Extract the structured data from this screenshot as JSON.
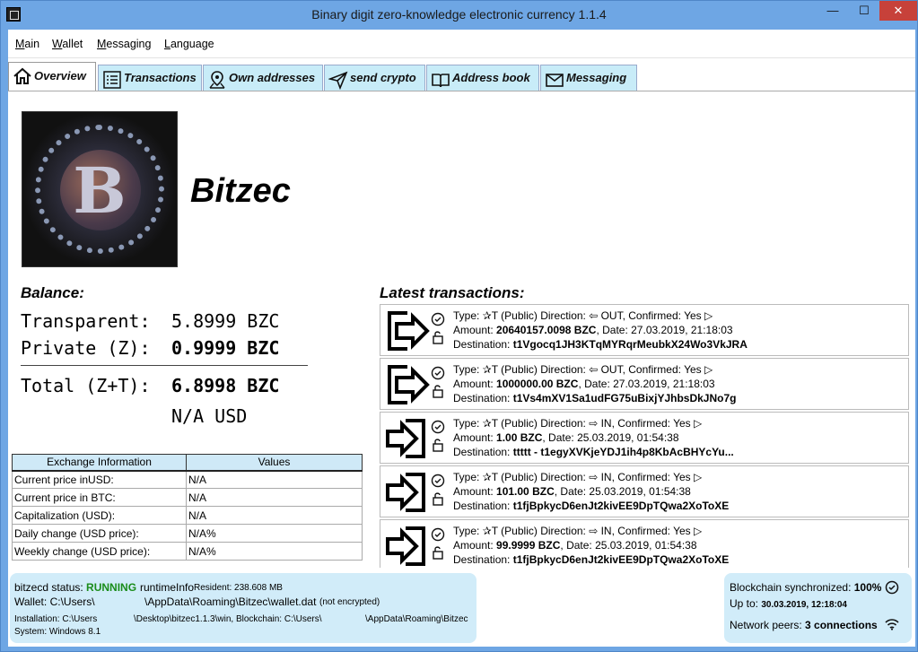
{
  "window": {
    "title": "Binary digit zero-knowledge electronic currency  1.1.4",
    "minimize": "—",
    "maximize": "☐",
    "close": "✕"
  },
  "menu": [
    "Main",
    "Wallet",
    "Messaging",
    "Language"
  ],
  "tabs": [
    {
      "label": "Overview",
      "icon": "home-icon"
    },
    {
      "label": "Transactions",
      "icon": "list-icon"
    },
    {
      "label": "Own addresses",
      "icon": "map-pin-icon"
    },
    {
      "label": "send crypto",
      "icon": "send-icon"
    },
    {
      "label": "Address book",
      "icon": "book-icon"
    },
    {
      "label": "Messaging",
      "icon": "envelope-icon"
    }
  ],
  "brand": "Bitzec",
  "balance": {
    "heading": "Balance:",
    "transparent_label": "Transparent:",
    "transparent_value": "5.8999 BZC",
    "private_label": "Private (Z):",
    "private_value": "0.9999 BZC",
    "total_label": "Total (Z+T):",
    "total_value": "6.8998 BZC",
    "usd_value": "N/A USD"
  },
  "exchange": {
    "headers": [
      "Exchange Information",
      "Values"
    ],
    "rows": [
      [
        "Current price inUSD:",
        "N/A"
      ],
      [
        "Current price in BTC:",
        "N/A"
      ],
      [
        "Capitalization (USD):",
        "N/A"
      ],
      [
        "Daily change (USD price):",
        "N/A%"
      ],
      [
        "Weekly change (USD price):",
        "N/A%"
      ]
    ]
  },
  "latest": {
    "heading": "Latest transactions:",
    "items": [
      {
        "direction": "out",
        "type": "Type: ✰T (Public) Direction: ⇦ OUT,  Confirmed: Yes ▷",
        "amount_label": "Amount: ",
        "amount": "20640157.0098 BZC",
        "date": ",  Date: 27.03.2019, 21:18:03",
        "dest_label": "Destination: ",
        "dest": "t1Vgocq1JH3KTqMYRqrMeubkX24Wo3VkJRA"
      },
      {
        "direction": "out",
        "type": "Type: ✰T (Public) Direction: ⇦ OUT,  Confirmed: Yes ▷",
        "amount_label": "Amount: ",
        "amount": "1000000.00 BZC",
        "date": ",  Date: 27.03.2019, 21:18:03",
        "dest_label": "Destination: ",
        "dest": "t1Vs4mXV1Sa1udFG75uBixjYJhbsDkJNo7g"
      },
      {
        "direction": "in",
        "type": "Type: ✰T (Public) Direction: ⇨ IN,  Confirmed: Yes ▷",
        "amount_label": "Amount: ",
        "amount": "1.00 BZC",
        "date": ",  Date: 25.03.2019, 01:54:38",
        "dest_label": "Destination: ",
        "dest": "ttttt - t1egyXVKjeYDJ1ih4p8KbAcBHYcYu..."
      },
      {
        "direction": "in",
        "type": "Type: ✰T (Public) Direction: ⇨ IN,  Confirmed: Yes ▷",
        "amount_label": "Amount: ",
        "amount": "101.00 BZC",
        "date": ",  Date: 25.03.2019, 01:54:38",
        "dest_label": "Destination: ",
        "dest": "t1fjBpkycD6enJt2kivEE9DpTQwa2XoToXE"
      },
      {
        "direction": "in",
        "type": "Type: ✰T (Public) Direction: ⇨ IN,  Confirmed: Yes ▷",
        "amount_label": "Amount: ",
        "amount": "99.9999 BZC",
        "date": ",  Date: 25.03.2019, 01:54:38",
        "dest_label": "Destination: ",
        "dest": "t1fjBpkycD6enJt2kivEE9DpTQwa2XoToXE"
      }
    ]
  },
  "status": {
    "daemon_label": "bitzecd status: ",
    "daemon_state": "RUNNING",
    "runtime_label": "runtimeInfo",
    "resident": "Resident: 238.608 MB",
    "wallet_label": "Wallet: C:\\Users\\",
    "wallet_path": "\\AppData\\Roaming\\Bitzec\\wallet.dat",
    "wallet_note": "(not encrypted)",
    "install_label": "Installation: C:\\Users",
    "install_path": "\\Desktop\\bitzec1.1.3\\win, Blockchain: C:\\Users\\",
    "chain_path": "\\AppData\\Roaming\\Bitzec",
    "system": "System: Windows 8.1",
    "sync_label": "Blockchain synchronized: ",
    "sync_value": "100%",
    "upto_label": "Up to: ",
    "upto_value": "30.03.2019, 12:18:04",
    "peers_label": "Network peers: ",
    "peers_value": "3 connections"
  }
}
